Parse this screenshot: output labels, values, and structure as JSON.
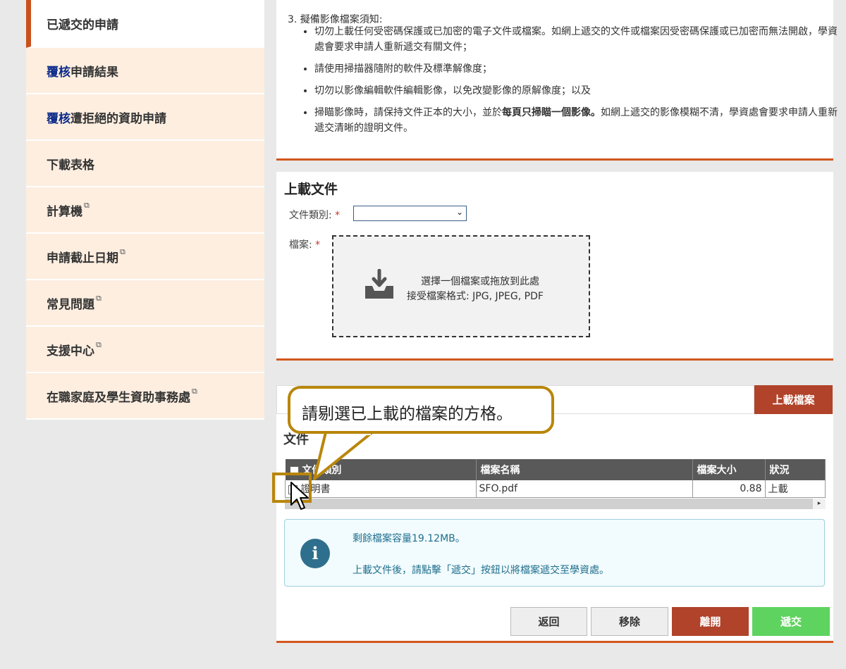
{
  "sidebar": {
    "items": [
      {
        "label": "已遞交的申請",
        "active": true
      },
      {
        "prefix": "覆核",
        "label": "申請結果"
      },
      {
        "prefix": "覆核",
        "label": "遭拒絕的資助申請"
      },
      {
        "label": "下載表格"
      },
      {
        "label": "計算機",
        "external": true
      },
      {
        "label": "申請截止日期",
        "external": true
      },
      {
        "label": "常見問題",
        "external": true
      },
      {
        "label": "支援中心",
        "external": true
      },
      {
        "label": "在職家庭及學生資助事務處",
        "external": true
      }
    ]
  },
  "notes": {
    "heading": "3. 擬備影像檔案須知:",
    "bullets": [
      "切勿上載任何受密碼保護或已加密的電子文件或檔案。如網上遞交的文件或檔案因受密碼保護或已加密而無法開啟，學資處會要求申請人重新遞交有關文件；",
      "請使用掃描器隨附的軟件及標準解像度；",
      "切勿以影像編輯軟件編輯影像，以免改變影像的原解像度；以及"
    ],
    "last_bullet_pre": "掃瞄影像時，請保持文件正本的大小，並於",
    "last_bullet_bold": "每頁只掃瞄一個影像。",
    "last_bullet_post": "如網上遞交的影像模糊不清，學資處會要求申請人重新遞交清晰的證明文件。"
  },
  "upload": {
    "title": "上載文件",
    "doc_type_label": "文件類別:",
    "doc_type_value": "",
    "file_label": "檔案:",
    "required_mark": "*",
    "dropzone_line1": "選擇一個檔案或拖放到此處",
    "dropzone_line2": "接受檔案格式: JPG, JPEG, PDF",
    "upload_button": "上載檔案"
  },
  "files": {
    "title": "文件",
    "columns": [
      "文件類別",
      "檔案名稱",
      "檔案大小",
      "狀況"
    ],
    "rows": [
      {
        "type": "證明書",
        "name": "SFO.pdf",
        "size": "0.88",
        "status": "上載"
      }
    ],
    "scroll_right_icon": "▸"
  },
  "info": {
    "icon": "info-icon",
    "line1": "剩餘檔案容量19.12MB。",
    "line2": "上載文件後，請點擊「遞交」按鈕以將檔案遞交至學資處。"
  },
  "actions": {
    "back": "返回",
    "remove": "移除",
    "leave": "離開",
    "submit": "遞交"
  },
  "callout": {
    "text": "請剔選已上載的檔案的方格。"
  },
  "colors": {
    "accent": "#d2571d",
    "leave": "#b0432a",
    "submit": "#5fd35f",
    "callout_border": "#b8860b"
  }
}
